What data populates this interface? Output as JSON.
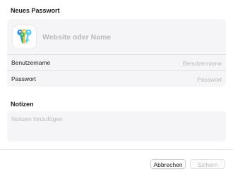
{
  "dialog": {
    "section_title": "Neues Passwort",
    "icon": "passwords-keys-icon"
  },
  "login": {
    "site": {
      "value": "",
      "placeholder": "Website oder Name"
    },
    "username": {
      "label": "Benutzername",
      "value": "",
      "placeholder": "Benutzername"
    },
    "password": {
      "label": "Passwort",
      "value": "",
      "placeholder": "Passwort"
    }
  },
  "notes": {
    "title": "Notizen",
    "value": "",
    "placeholder": "Notizen hinzufügen"
  },
  "buttons": {
    "cancel_label": "Abbrechen",
    "save_label": "Sichern",
    "save_enabled": false
  },
  "colors": {
    "key_blue": "#3b8ee8",
    "key_yellow": "#f5c53a",
    "key_green": "#41b86a",
    "key_cyan": "#5ad0f0",
    "placeholder": "#b9b9bd"
  }
}
